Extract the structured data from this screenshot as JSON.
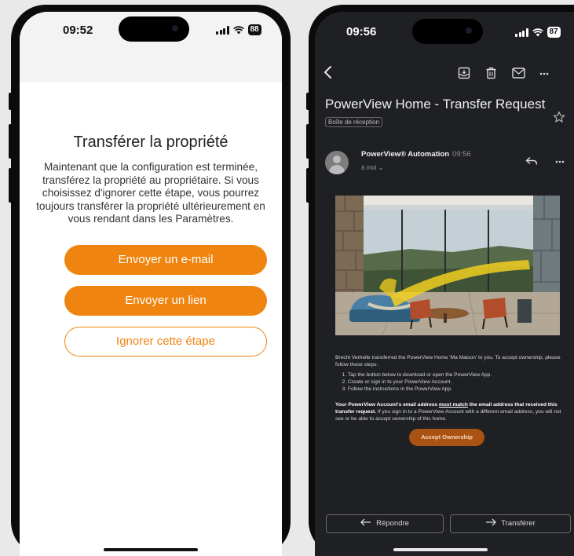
{
  "colors": {
    "accent_orange": "#ef8510",
    "email_bg": "#1f2023",
    "accept_button": "#a85214"
  },
  "setup_screen": {
    "status": {
      "time": "09:52",
      "battery": "88"
    },
    "title": "Transférer la propriété",
    "body_lines": [
      "Maintenant que la configuration est terminée,",
      "transférez la propriété au propriétaire. Si vous",
      "choisissez d'ignorer cette étape, vous pourrez",
      "toujours transférer la propriété ultérieurement en",
      "vous rendant dans les Paramètres."
    ],
    "buttons": {
      "email": "Envoyer un e-mail",
      "link": "Envoyer un lien",
      "skip": "Ignorer cette étape"
    }
  },
  "email_screen": {
    "status": {
      "time": "09:56",
      "battery": "87"
    },
    "toolbar_icons": [
      "back-arrow-icon",
      "archive-icon",
      "trash-icon",
      "mail-icon",
      "more-icon"
    ],
    "subject": "PowerView Home - Transfer Request",
    "folder_tag": "Boîte de réception",
    "sender": {
      "name": "PowerView® Automation",
      "time": "09:56",
      "recipient": "à moi ⌄"
    },
    "body": {
      "intro": "Brecht Verhelle transferred the PowerView Home 'Ma Maison' to you. To accept ownership, please follow these steps:",
      "steps": [
        "Tap the button below to download or open the PowerView App.",
        "Create or sign in to your PowerView Account.",
        "Follow the instructions in the PowerView App."
      ],
      "warning_bold_1": "Your PowerView Account's email address ",
      "warning_underlined": "must match",
      "warning_bold_2": " the email address that received this transfer request.",
      "warning_rest": " If you sign in to a PowerView Account with a different email address, you will not see or be able to accept ownership of this home."
    },
    "accept_button": "Accept Ownership",
    "reply_button": "Répondre",
    "forward_button": "Transférer"
  }
}
